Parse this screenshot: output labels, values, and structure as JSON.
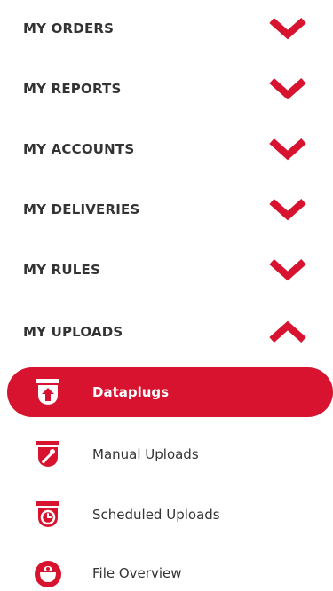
{
  "theme": {
    "accent": "#d7132f",
    "text": "#333333",
    "active_text": "#ffffff"
  },
  "sections": [
    {
      "label": "MY ORDERS",
      "state": "collapsed",
      "icon": "chevron-down-icon"
    },
    {
      "label": "MY REPORTS",
      "state": "collapsed",
      "icon": "chevron-down-icon"
    },
    {
      "label": "MY ACCOUNTS",
      "state": "collapsed",
      "icon": "chevron-down-icon"
    },
    {
      "label": "MY DELIVERIES",
      "state": "collapsed",
      "icon": "chevron-down-icon"
    },
    {
      "label": "MY RULES",
      "state": "collapsed",
      "icon": "chevron-down-icon"
    },
    {
      "label": "MY UPLOADS",
      "state": "expanded",
      "icon": "chevron-up-icon"
    }
  ],
  "uploads": {
    "items": [
      {
        "label": "Dataplugs",
        "icon": "dataplug-upload-icon",
        "active": true
      },
      {
        "label": "Manual Uploads",
        "icon": "manual-upload-icon",
        "active": false
      },
      {
        "label": "Scheduled Uploads",
        "icon": "scheduled-upload-icon",
        "active": false
      },
      {
        "label": "File Overview",
        "icon": "file-overview-icon",
        "active": false
      }
    ]
  }
}
